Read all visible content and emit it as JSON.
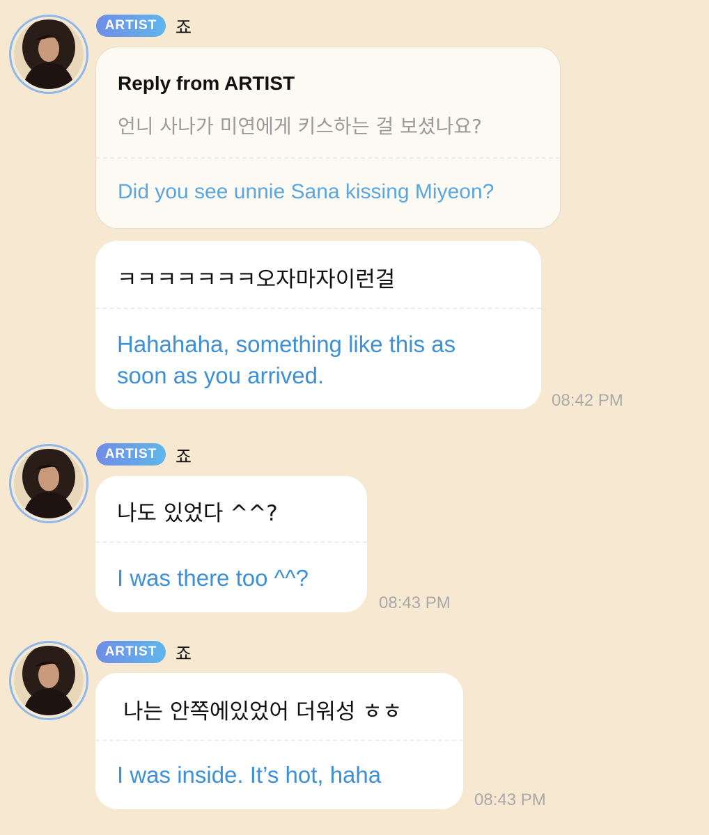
{
  "messages": [
    {
      "badge": "ARTIST",
      "sender": "죠",
      "reply": {
        "title": "Reply from ARTIST",
        "original": "언니 사나가 미연에게 키스하는 걸 보셨나요?",
        "translation": "Did you see unnie Sana kissing Miyeon?"
      },
      "original": "ㅋㅋㅋㅋㅋㅋㅋ오자마자이런걸",
      "translation_line1": "Hahahaha, something like this as",
      "translation_line2": "soon as you arrived.",
      "time": "08:42 PM"
    },
    {
      "badge": "ARTIST",
      "sender": "죠",
      "original": "나도 있었다 ^^?",
      "translation": "I was there too ^^?",
      "time": "08:43 PM"
    },
    {
      "badge": "ARTIST",
      "sender": "죠",
      "original": "나는 안쪽에있었어 더워성 ㅎㅎ",
      "translation": "I was inside. It’s hot, haha",
      "time": "08:43 PM"
    }
  ],
  "colors": {
    "background": "#f7e8d2",
    "bubble": "#ffffff",
    "reply_bubble": "#fdf9f3",
    "translation_text": "#3d8fd6",
    "badge_gradient_start": "#6f8de6",
    "badge_gradient_end": "#5fb6ea",
    "avatar_ring": "#8fb7e8"
  },
  "icons": {
    "avatar": "artist-profile-photo"
  }
}
